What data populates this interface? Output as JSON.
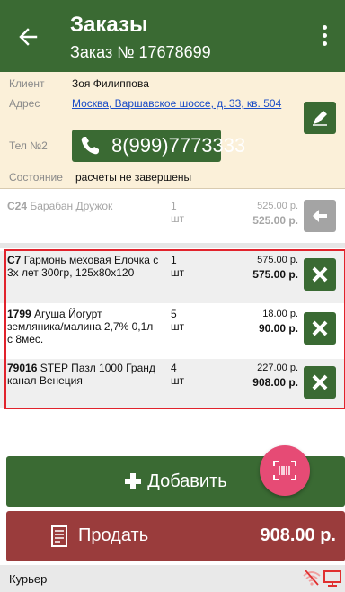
{
  "header": {
    "title": "Заказы",
    "subtitle": "Заказ № 17678699",
    "back_icon": "arrow-left-icon",
    "menu_icon": "more-vertical-icon"
  },
  "client": {
    "client_label": "Клиент",
    "client_name": "Зоя Филиппова",
    "address_label": "Адрес",
    "address": "Москва, Варшавское шоссе, д. 33, кв. 504",
    "phone_label": "Тел №2",
    "phone": "8(999)7773333",
    "state_label": "Состояние",
    "state_value": "расчеты не завершены"
  },
  "items": [
    {
      "code": "С24",
      "name": "Барабан Дружок",
      "qty": "1",
      "unit": "шт",
      "price": "525.00 р.",
      "total": "525.00 р."
    },
    {
      "code": "C7",
      "name": "Гармонь меховая Елочка с 3х лет 300гр, 125х80х120",
      "qty": "1",
      "unit": "шт",
      "price": "575.00 р.",
      "total": "575.00 р."
    },
    {
      "code": "1799",
      "name": "Агуша Йогурт земляника/малина 2,7% 0,1л с 8мес.",
      "qty": "5",
      "unit": "шт",
      "price": "18.00 р.",
      "total": "90.00 р."
    },
    {
      "code": "79016",
      "name": "STEP Пазл 1000 Гранд канал Венеция",
      "qty": "4",
      "unit": "шт",
      "price": "227.00 р.",
      "total": "908.00 р."
    }
  ],
  "actions": {
    "add_label": "Добавить",
    "sell_label": "Продать",
    "sell_total": "908.00 р."
  },
  "footer": {
    "courier_label": "Курьер"
  },
  "colors": {
    "primary_green": "#3a6a33",
    "sell_red": "#9a3c3c",
    "fab_pink": "#e64b75",
    "client_bg": "#fbf0d9",
    "selection_red": "#e1232c"
  }
}
